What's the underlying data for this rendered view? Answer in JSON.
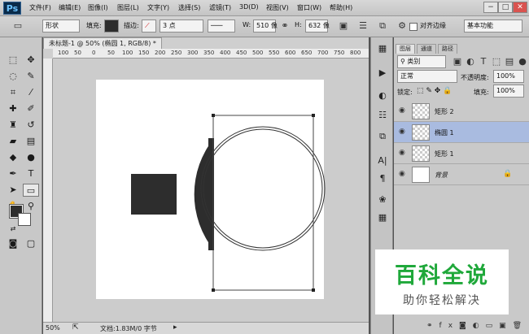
{
  "app": {
    "logo": "Ps"
  },
  "menu": [
    "文件(F)",
    "编辑(E)",
    "图像(I)",
    "图层(L)",
    "文字(Y)",
    "选择(S)",
    "滤镜(T)",
    "3D(D)",
    "视图(V)",
    "窗口(W)",
    "帮助(H)"
  ],
  "window_controls": {
    "minimize": "−",
    "maximize": "□",
    "close": "✕"
  },
  "options": {
    "mode": "形状",
    "fill_label": "填充:",
    "stroke_label": "描边:",
    "stroke_size": "3 点",
    "w_label": "W:",
    "w_value": "510 像",
    "h_label": "H:",
    "h_value": "632 像",
    "align_edges": "对齐边缘",
    "workspace": "基本功能"
  },
  "document": {
    "tab": "未标题-1 @ 50% (椭圆 1, RGB/8) *",
    "ruler_marks": [
      "100",
      "50",
      "0",
      "50",
      "100",
      "150",
      "200",
      "250",
      "300",
      "350",
      "400",
      "450",
      "500",
      "550",
      "600",
      "650",
      "700",
      "750",
      "800"
    ],
    "zoom": "50%",
    "doc_info": "文档:1.83M/0 字节"
  },
  "layers_panel": {
    "tabs": [
      "图层",
      "通道",
      "路径"
    ],
    "filter_kind": "类别",
    "blend_mode": "正常",
    "opacity_label": "不透明度:",
    "opacity_value": "100%",
    "lock_label": "锁定:",
    "fill_label": "填充:",
    "fill_value": "100%",
    "layers": [
      {
        "name": "矩形 2",
        "selected": false
      },
      {
        "name": "椭圆 1",
        "selected": true
      },
      {
        "name": "矩形 1",
        "selected": false
      },
      {
        "name": "背景",
        "selected": false
      }
    ]
  },
  "watermark": {
    "title": "百科全说",
    "subtitle": "助你轻松解决"
  },
  "colors": {
    "accent_selected": "#a9bbe0",
    "shape_fill": "#2d2d2d",
    "watermark_green": "#1fa83a"
  }
}
